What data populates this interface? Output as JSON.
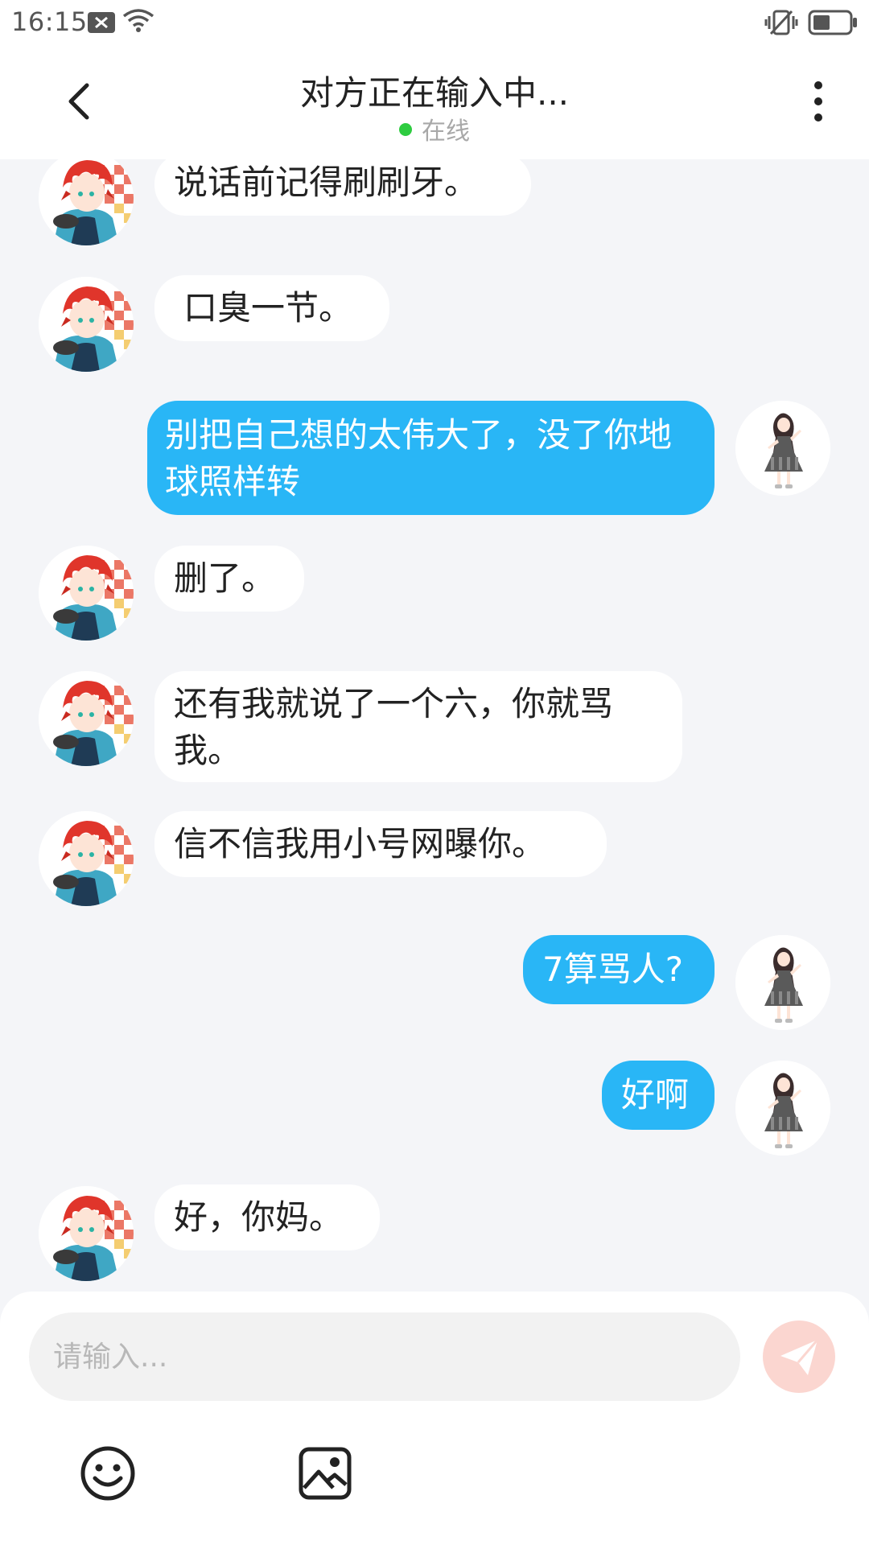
{
  "status_bar": {
    "time": "16:15"
  },
  "header": {
    "title": "对方正在输入中...",
    "online_status": "在线"
  },
  "messages": [
    {
      "side": "in",
      "text": "说话前记得刷刷牙。"
    },
    {
      "side": "in",
      "text": "口臭一节。"
    },
    {
      "side": "out",
      "text": "别把自己想的太伟大了，没了你地球照样转"
    },
    {
      "side": "in",
      "text": "删了。"
    },
    {
      "side": "in",
      "text": "还有我就说了一个六，你就骂我。"
    },
    {
      "side": "in",
      "text": "信不信我用小号网曝你。"
    },
    {
      "side": "out",
      "text": "7算骂人?"
    },
    {
      "side": "out",
      "text": "好啊"
    },
    {
      "side": "in",
      "text": "好，你妈。"
    }
  ],
  "composer": {
    "placeholder": "请输入..."
  },
  "icons": {
    "back": "chevron-left-icon",
    "more": "more-vertical-icon",
    "send": "send-icon",
    "emoji": "emoji-icon",
    "image": "image-icon"
  },
  "colors": {
    "outgoing_bubble": "#29b6f6",
    "incoming_bubble": "#ffffff",
    "background": "#f4f5f8",
    "online_dot": "#2ecc40",
    "send_button": "#fbd6d0"
  }
}
